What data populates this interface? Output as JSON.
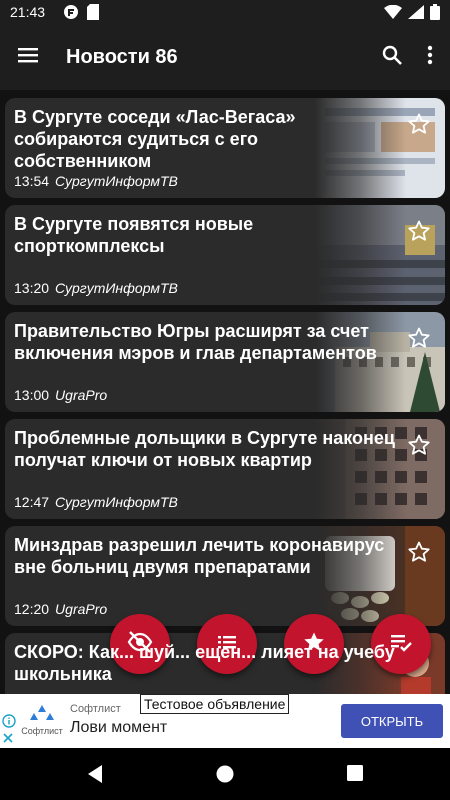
{
  "status_bar": {
    "time": "21:43",
    "icons": [
      "app-notification-icon",
      "sd-card-icon",
      "wifi-icon",
      "signal-icon",
      "battery-icon"
    ]
  },
  "app_bar": {
    "title": "Новости 86",
    "icons": [
      "menu-icon",
      "search-icon",
      "more-vert-icon"
    ]
  },
  "articles": [
    {
      "headline": "В Сургуте соседи «Лас-Вегаса» собираются судиться с его собственником",
      "time": "13:54",
      "source": "СургутИнформТВ",
      "thumb": "screenshot-thumb"
    },
    {
      "headline": "В Сургуте появятся новые спорткомплексы",
      "time": "13:20",
      "source": "СургутИнформТВ",
      "thumb": "meeting-hall-thumb"
    },
    {
      "headline": "Правительство Югры расширят за счет включения мэров и глав департаментов",
      "time": "13:00",
      "source": "UgraPro",
      "thumb": "government-building-thumb"
    },
    {
      "headline": "Проблемные дольщики в Сургуте наконец получат ключи от новых квартир",
      "time": "12:47",
      "source": "СургутИнформТВ",
      "thumb": "apartment-building-thumb"
    },
    {
      "headline": "Минздрав разрешил лечить коронавирус вне больниц двумя препаратами",
      "time": "12:20",
      "source": "UgraPro",
      "thumb": "pills-thumb"
    },
    {
      "headline": "СКОРО: Как... шуй... ещен... лияет на учебу школьника",
      "time": "",
      "source": "",
      "thumb": "kids-thumb"
    }
  ],
  "fabs": [
    "hide-read-icon",
    "list-icon",
    "favorites-star-icon",
    "mark-read-icon"
  ],
  "ad": {
    "logo_text": "Софтлист",
    "brand": "Софтлист",
    "slogan": "Лови момент",
    "test_label": "Тестовое объявление",
    "cta": "ОТКРЫТЬ"
  },
  "colors": {
    "background": "#121212",
    "bar": "#1e1e1e",
    "card": "#2b2b2b",
    "accent": "#c2152d",
    "ad_button": "#3f51b5"
  }
}
